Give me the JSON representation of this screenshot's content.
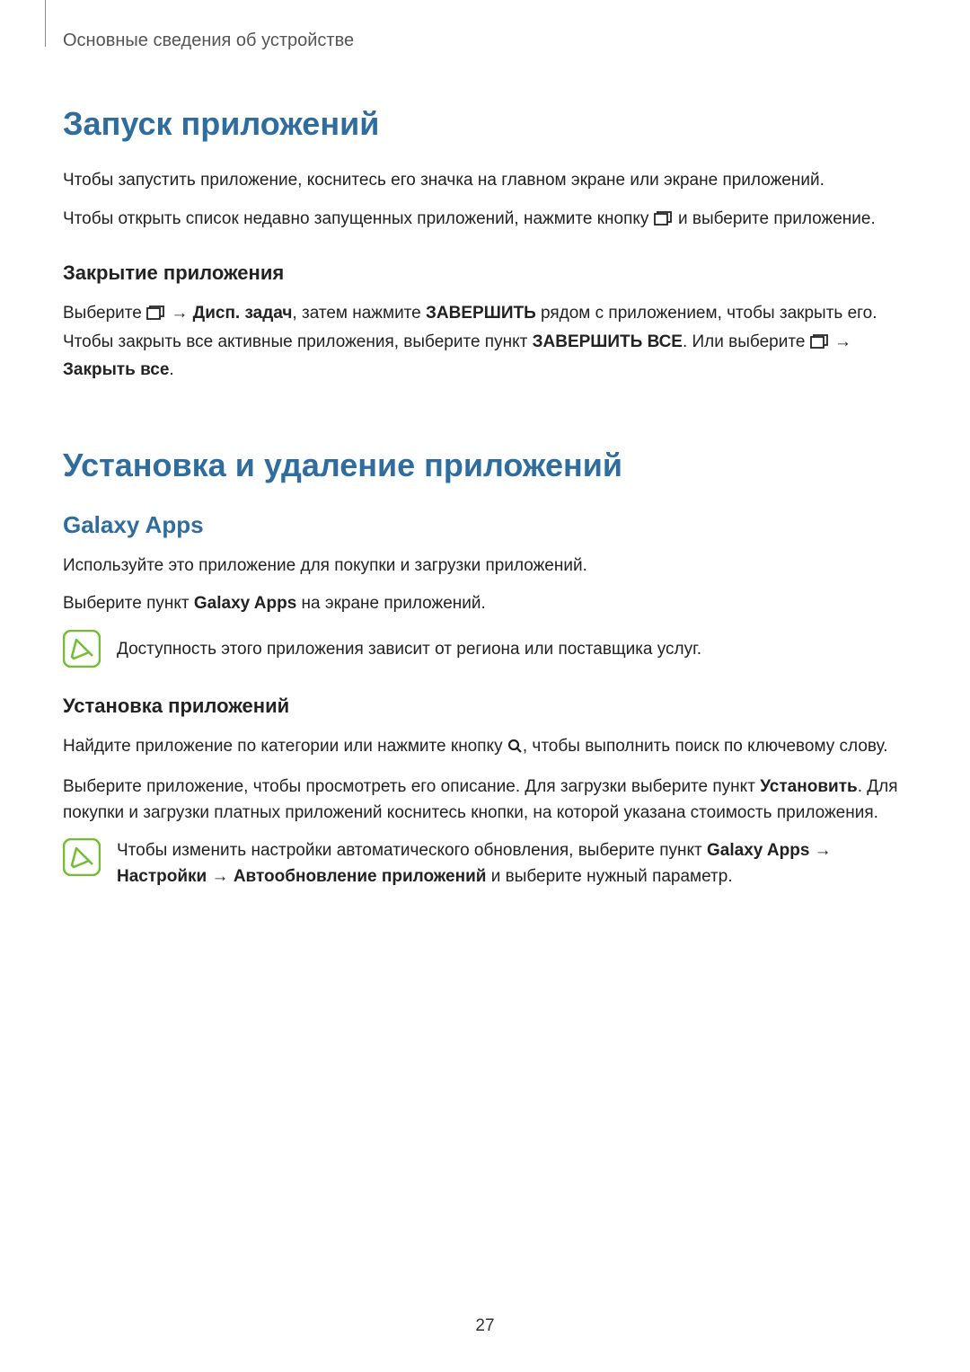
{
  "header": "Основные сведения об устройстве",
  "s1": {
    "h1": "Запуск приложений",
    "p1": "Чтобы запустить приложение, коснитесь его значка на главном экране или экране приложений.",
    "p2a": "Чтобы открыть список недавно запущенных приложений, нажмите кнопку ",
    "p2b": " и выберите приложение.",
    "h2": "Закрытие приложения",
    "p3a": "Выберите ",
    "p3b": " → ",
    "p3c": "Дисп. задач",
    "p3d": ", затем нажмите ",
    "p3e": "ЗАВЕРШИТЬ",
    "p3f": " рядом с приложением, чтобы закрыть его. Чтобы закрыть все активные приложения, выберите пункт ",
    "p3g": "ЗАВЕРШИТЬ ВСЕ",
    "p3h": ". Или выберите ",
    "p3i": " → ",
    "p3j": "Закрыть все",
    "p3k": "."
  },
  "s2": {
    "h1": "Установка и удаление приложений",
    "h3": "Galaxy Apps",
    "p1": "Используйте это приложение для покупки и загрузки приложений.",
    "p2a": "Выберите пункт ",
    "p2b": "Galaxy Apps",
    "p2c": " на экране приложений.",
    "note1": "Доступность этого приложения зависит от региона или поставщика услуг.",
    "h2": "Установка приложений",
    "p3a": "Найдите приложение по категории или нажмите кнопку ",
    "p3b": ", чтобы выполнить поиск по ключевому слову.",
    "p4a": "Выберите приложение, чтобы просмотреть его описание. Для загрузки выберите пункт ",
    "p4b": "Установить",
    "p4c": ". Для покупки и загрузки платных приложений коснитесь кнопки, на которой указана стоимость приложения.",
    "note2a": "Чтобы изменить настройки автоматического обновления, выберите пункт ",
    "note2b": "Galaxy Apps",
    "note2c": " → ",
    "note2d": "Настройки",
    "note2e": " → ",
    "note2f": "Автообновление приложений",
    "note2g": " и выберите нужный параметр."
  },
  "pageNumber": "27"
}
